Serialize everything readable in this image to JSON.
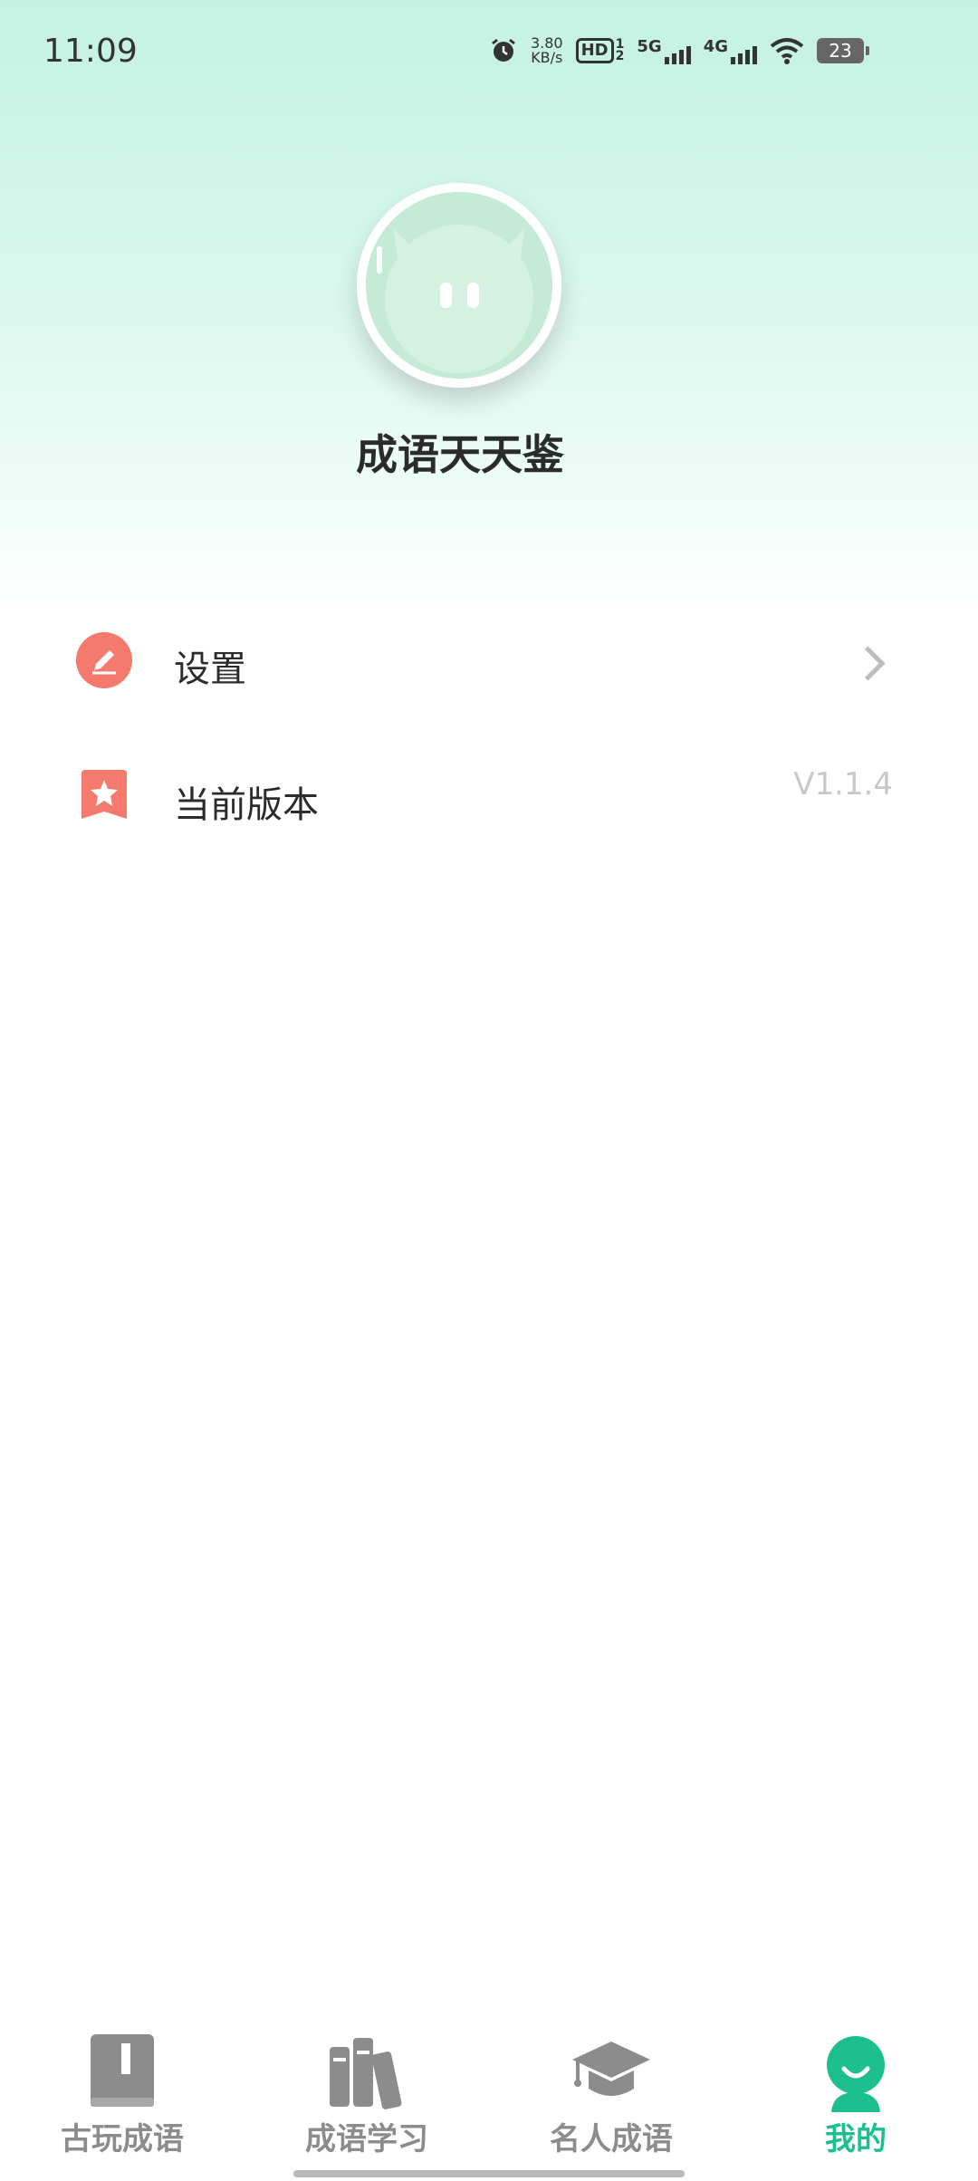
{
  "status_bar": {
    "time": "11:09",
    "net_speed_value": "3.80",
    "net_speed_unit": "KB/s",
    "hd_label": "HD",
    "hd_sub_top": "1",
    "hd_sub_bottom": "2",
    "signal1_label": "5G",
    "signal2_label": "4G",
    "battery": "23"
  },
  "profile": {
    "app_name": "成语天天鉴"
  },
  "menu": {
    "settings_label": "设置",
    "version_label": "当前版本",
    "version_value": "V1.1.4"
  },
  "tabs": [
    {
      "label": "古玩成语",
      "icon": "book-icon",
      "active": false
    },
    {
      "label": "成语学习",
      "icon": "books-icon",
      "active": false
    },
    {
      "label": "名人成语",
      "icon": "graduation-cap-icon",
      "active": false
    },
    {
      "label": "我的",
      "icon": "profile-icon",
      "active": true
    }
  ],
  "colors": {
    "accent": "#1dbf8f",
    "menu_icon": "#f47a6e",
    "inactive_tab": "#8c8c8c",
    "header_gradient_top": "#c4f2e2"
  }
}
